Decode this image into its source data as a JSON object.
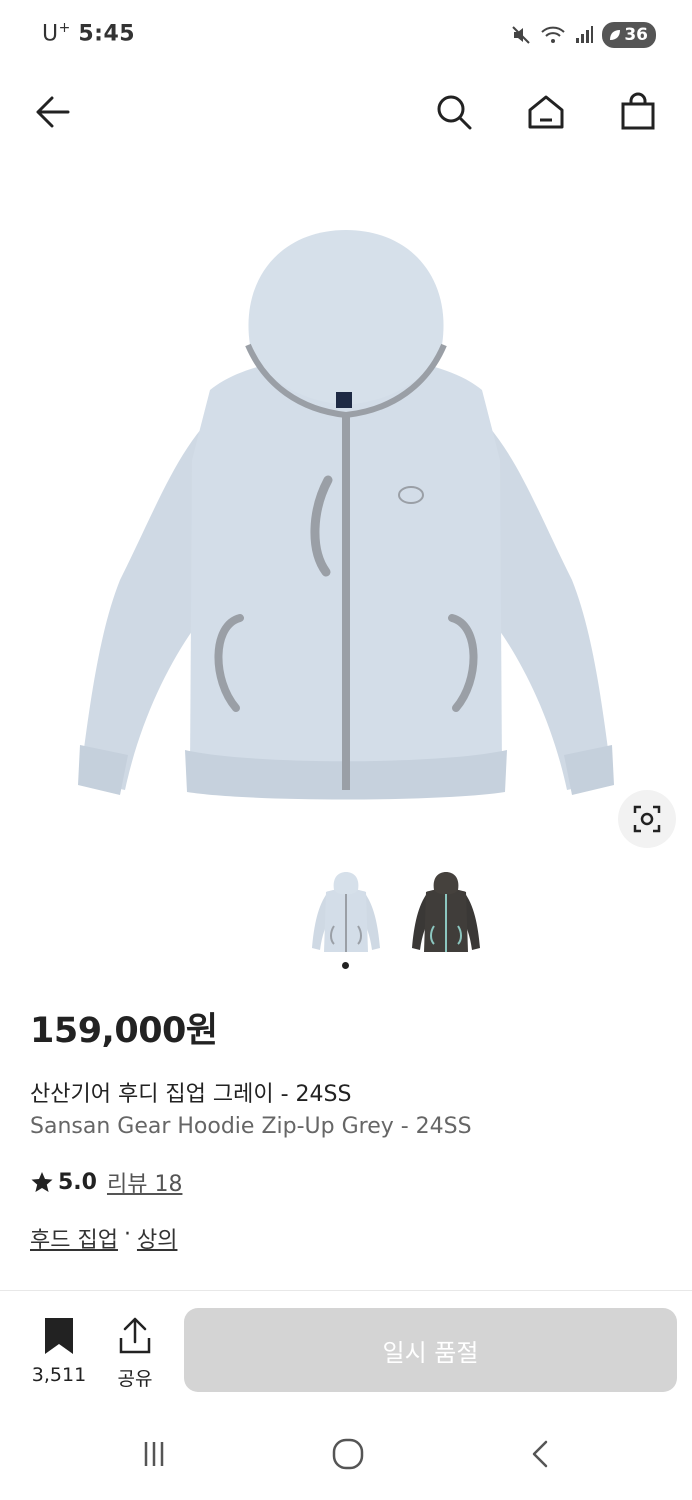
{
  "status_bar": {
    "carrier": "U",
    "carrier_sup": "+",
    "time": "5:45",
    "battery": "36"
  },
  "icons": {
    "back": "arrow-left-icon",
    "search": "search-icon",
    "home": "home-icon",
    "cart": "shopping-bag-icon",
    "lens": "visual-search-icon",
    "bookmark": "bookmark-icon",
    "share": "share-icon"
  },
  "product": {
    "price": "159,000원",
    "name_ko": "산산기어 후디 집업 그레이 - 24SS",
    "name_en": "Sansan Gear Hoodie Zip-Up Grey - 24SS",
    "rating": "5.0",
    "review_label": "리뷰 18",
    "categories": [
      "후드 집업",
      "상의"
    ],
    "category_sep": "·",
    "thumbnails": [
      "grey",
      "black"
    ],
    "colors": {
      "grey": "#cfd9e4",
      "trim": "#9a9fa6",
      "black": "#3a3836"
    }
  },
  "bottom_bar": {
    "bookmark_count": "3,511",
    "share_label": "공유",
    "soldout_label": "일시 품절"
  }
}
